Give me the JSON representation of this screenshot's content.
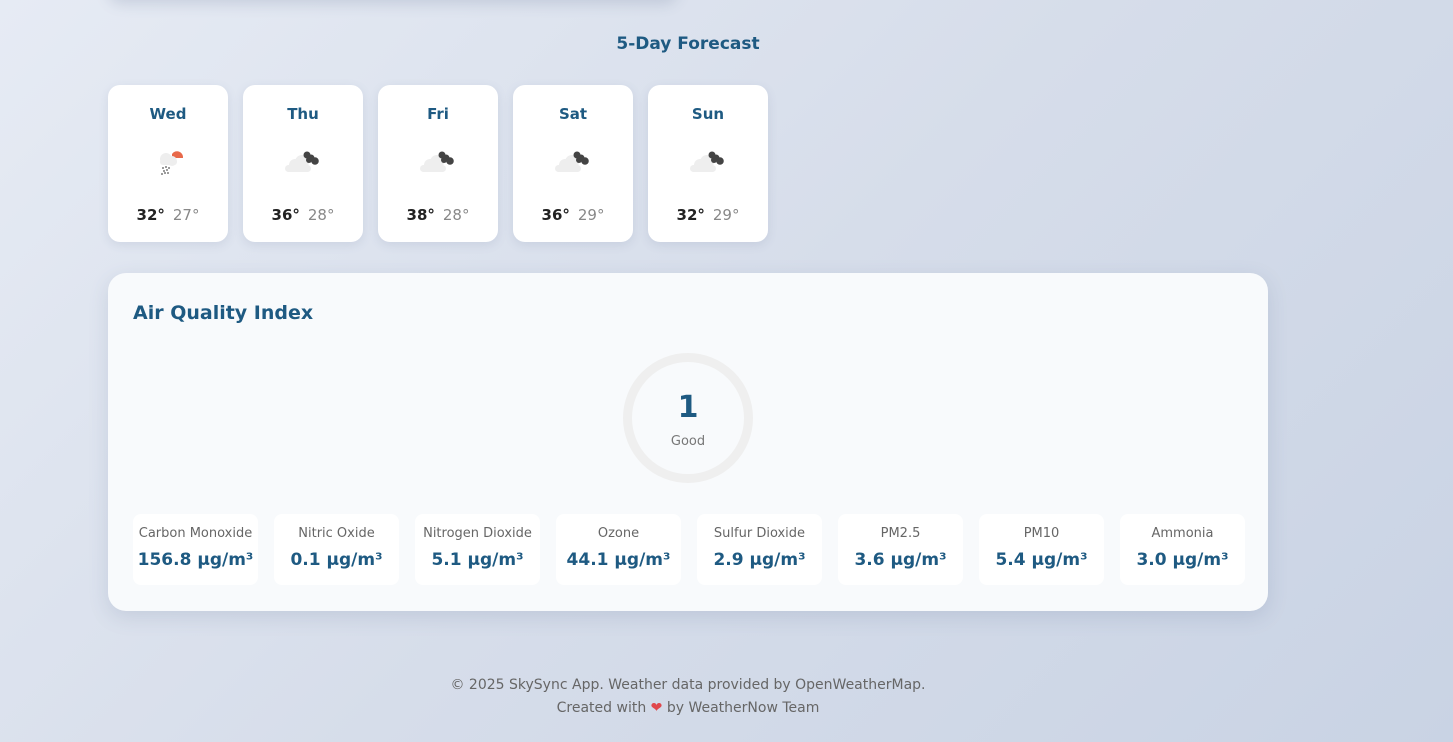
{
  "forecast": {
    "title": "5-Day Forecast",
    "days": [
      {
        "day": "Wed",
        "high": "32°",
        "low": "27°",
        "icon": "rain-cloud-sun-icon"
      },
      {
        "day": "Thu",
        "high": "36°",
        "low": "28°",
        "icon": "broken-clouds-icon"
      },
      {
        "day": "Fri",
        "high": "38°",
        "low": "28°",
        "icon": "broken-clouds-icon"
      },
      {
        "day": "Sat",
        "high": "36°",
        "low": "29°",
        "icon": "broken-clouds-icon"
      },
      {
        "day": "Sun",
        "high": "32°",
        "low": "29°",
        "icon": "broken-clouds-icon"
      }
    ]
  },
  "air_quality": {
    "title": "Air Quality Index",
    "aqi_value": "1",
    "aqi_label": "Good",
    "pollutants": [
      {
        "name": "Carbon Monoxide",
        "value": "156.8 μg/m³"
      },
      {
        "name": "Nitric Oxide",
        "value": "0.1 μg/m³"
      },
      {
        "name": "Nitrogen Dioxide",
        "value": "5.1 μg/m³"
      },
      {
        "name": "Ozone",
        "value": "44.1 μg/m³"
      },
      {
        "name": "Sulfur Dioxide",
        "value": "2.9 μg/m³"
      },
      {
        "name": "PM2.5",
        "value": "3.6 μg/m³"
      },
      {
        "name": "PM10",
        "value": "5.4 μg/m³"
      },
      {
        "name": "Ammonia",
        "value": "3.0 μg/m³"
      }
    ]
  },
  "footer": {
    "line1": "© 2025 SkySync App. Weather data provided by OpenWeatherMap.",
    "line2_prefix": "Created with",
    "line2_suffix": "by WeatherNow Team",
    "heart_icon": "heart-icon"
  },
  "colors": {
    "accent": "#1e5a82",
    "heart": "#e0474c",
    "sun": "#e8694a"
  }
}
